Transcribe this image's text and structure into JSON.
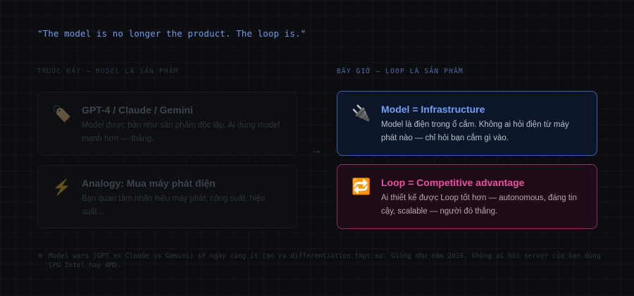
{
  "quote": "\"The model is no longer the product. The loop is.\"",
  "before": {
    "label": "TRƯỚC ĐÂY — MODEL LÀ SẢN PHẨM",
    "cards": [
      {
        "icon": "🏷️",
        "icon_name": "price-tag-icon",
        "title": "GPT-4 / Claude / Gemini",
        "desc": "Model được bán như sản phẩm độc lập. Ai dùng model mạnh hơn — thắng."
      },
      {
        "icon": "⚡",
        "icon_name": "lightning-icon",
        "title": "Analogy: Mua máy phát điện",
        "desc": "Bạn quan tâm nhãn hiệu máy phát, công suất, hiệu suất..."
      }
    ]
  },
  "arrow": "→",
  "now": {
    "label": "BÂY GIỜ — LOOP LÀ SẢN PHẨM",
    "cards": [
      {
        "icon": "🔌",
        "icon_name": "plug-icon",
        "title": "Model = Infrastructure",
        "desc": "Model là điện trong ổ cắm. Không ai hỏi điện từ máy phát nào — chỉ hỏi bạn cắm gì vào."
      },
      {
        "icon": "🔁",
        "icon_name": "repeat-loop-icon",
        "title": "Loop = Competitive advantage",
        "desc": "Ai thiết kế được Loop tốt hơn — autonomous, đáng tin cậy, scalable — người đó thắng."
      }
    ]
  },
  "footnote": {
    "mark": "※",
    "text": "Model wars (GPT vs Claude vs Gemini) sẽ ngày càng ít tạo ra differentiation thực sự. Giống như năm 2010, không ai hỏi server của bạn dùng CPU Intel hay AMD."
  },
  "colors": {
    "quote": "#6e9bf0",
    "infra_accent": "#6ea0f5",
    "loop_accent": "#ec4f9f"
  }
}
